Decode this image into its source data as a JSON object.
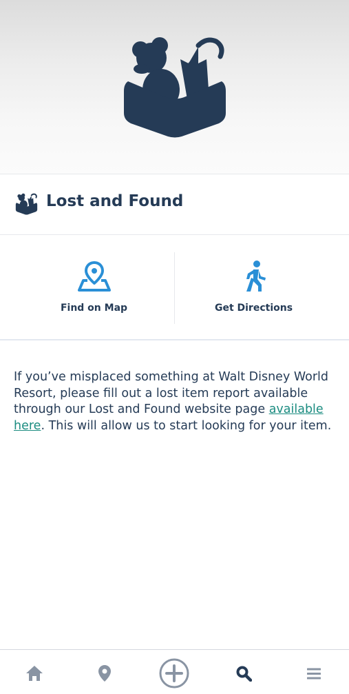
{
  "hero": {
    "icon": "lost-and-found-icon"
  },
  "header": {
    "title": "Lost and Found",
    "icon": "lost-and-found-icon"
  },
  "actions": [
    {
      "label": "Find on Map",
      "icon": "map-pin-icon"
    },
    {
      "label": "Get Directions",
      "icon": "walking-person-icon"
    }
  ],
  "description": {
    "text_before": "If you’ve misplaced something at Walt Disney World Resort, please fill out a lost item report available through our Lost and Found website page ",
    "link_text": "available here",
    "text_after": ". This will allow us to start looking for your item."
  },
  "tabbar": {
    "items": [
      {
        "icon": "home-icon",
        "active": false
      },
      {
        "icon": "location-pin-icon",
        "active": false
      },
      {
        "icon": "plus-circle-icon",
        "active": false
      },
      {
        "icon": "search-icon",
        "active": true
      },
      {
        "icon": "menu-icon",
        "active": false
      }
    ]
  },
  "colors": {
    "navy": "#253b56",
    "accent_blue": "#2a8fd6",
    "link_teal": "#1b8c80",
    "tab_inactive": "#8994a3"
  }
}
